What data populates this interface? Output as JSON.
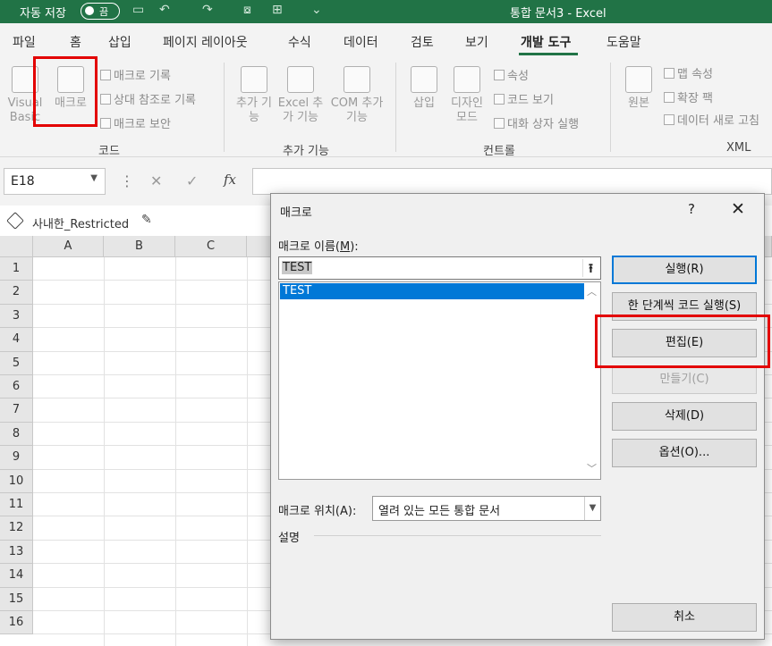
{
  "titlebar": {
    "autosave_label": "자동 저장",
    "autosave_state": "끔",
    "doc_title": "통합 문서3  -  Excel"
  },
  "tabs": [
    "파일",
    "홈",
    "삽입",
    "페이지 레이아웃",
    "수식",
    "데이터",
    "검토",
    "보기",
    "개발 도구",
    "도움말"
  ],
  "active_tab": "개발 도구",
  "ribbon": {
    "code": {
      "visual_basic": "Visual Basic",
      "macro": "매크로",
      "record_macro": "매크로 기록",
      "relative_ref": "상대 참조로 기록",
      "macro_security": "매크로 보안",
      "group_label": "코드"
    },
    "addins": {
      "addins": "추가 기능",
      "excel_addins": "Excel 추가 기능",
      "com_addins": "COM 추가 기능",
      "group_label": "추가 기능"
    },
    "controls": {
      "insert": "삽입",
      "design_mode": "디자인 모드",
      "properties": "속성",
      "view_code": "코드 보기",
      "run_dialog": "대화 상자 실행",
      "group_label": "컨트롤"
    },
    "xml": {
      "source": "원본",
      "map_properties": "맵 속성",
      "expansion_packs": "확장 팩",
      "refresh_data": "데이터 새로 고침",
      "group_label": "XML"
    }
  },
  "formula_bar": {
    "name_box": "E18",
    "fx": "fx"
  },
  "sensitivity": {
    "label": "사내한_Restricted"
  },
  "grid": {
    "columns": [
      "A",
      "B",
      "C"
    ],
    "rows": [
      "1",
      "2",
      "3",
      "4",
      "5",
      "6",
      "7",
      "8",
      "9",
      "10",
      "11",
      "12",
      "13",
      "14",
      "15",
      "16"
    ]
  },
  "dialog": {
    "title": "매크로",
    "help": "?",
    "close": "✕",
    "name_label": "매크로 이름(",
    "name_key": "M",
    "name_label_end": "):",
    "name_value": "TEST",
    "list_items": [
      "TEST"
    ],
    "buttons": {
      "run": "실행(R)",
      "step_into": "한 단계씩 코드 실행(S)",
      "edit": "편집(E)",
      "create": "만들기(C)",
      "delete": "삭제(D)",
      "options": "옵션(O)...",
      "cancel": "취소"
    },
    "location_label": "매크로 위치(A):",
    "location_value": "열려 있는 모든 통합 문서",
    "description_label": "설명"
  },
  "colors": {
    "excel_green": "#217346",
    "highlight_red": "#e30000",
    "selection_blue": "#0078d7"
  }
}
